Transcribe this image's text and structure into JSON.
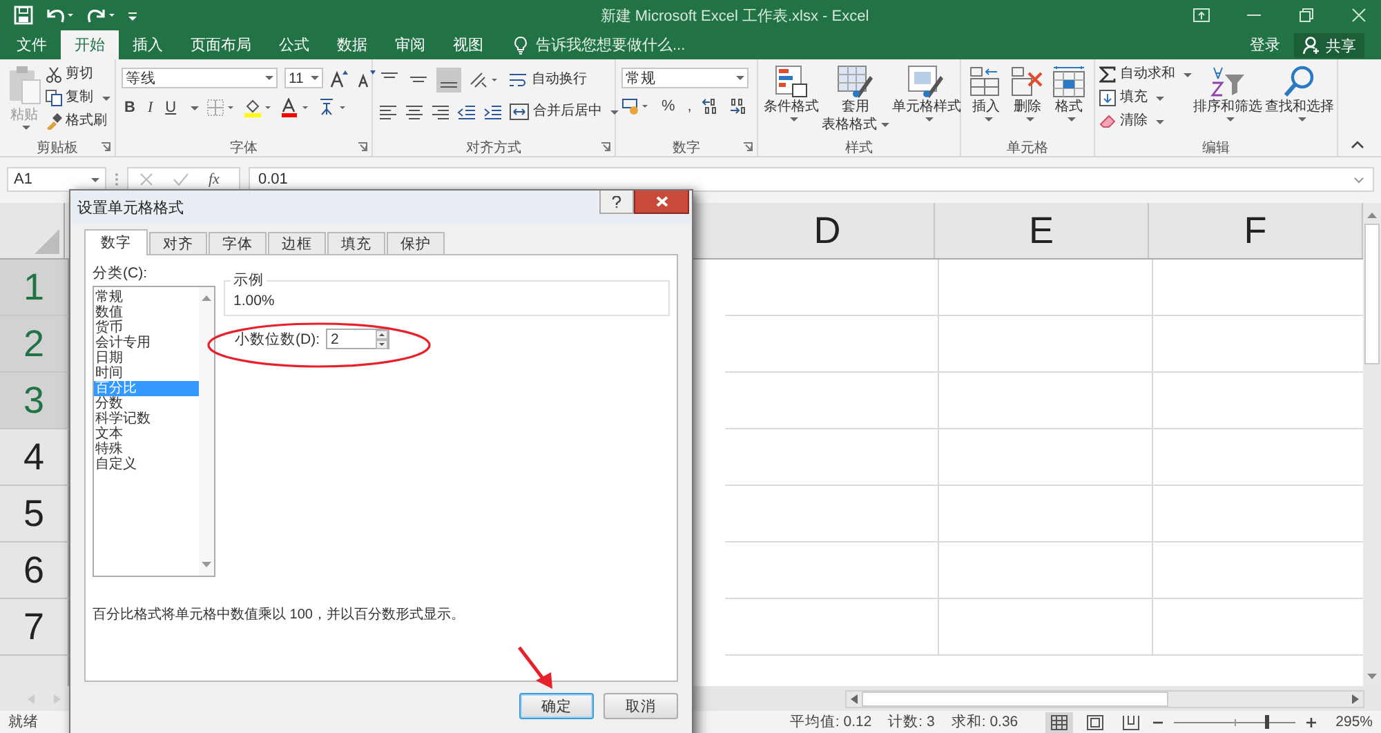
{
  "window": {
    "title": "新建 Microsoft Excel 工作表.xlsx - Excel"
  },
  "menu_tabs": [
    {
      "label": "文件",
      "selected": false
    },
    {
      "label": "开始",
      "selected": true
    },
    {
      "label": "插入",
      "selected": false
    },
    {
      "label": "页面布局",
      "selected": false
    },
    {
      "label": "公式",
      "selected": false
    },
    {
      "label": "数据",
      "selected": false
    },
    {
      "label": "审阅",
      "selected": false
    },
    {
      "label": "视图",
      "selected": false
    }
  ],
  "tell_me": {
    "placeholder": "告诉我您想要做什么..."
  },
  "account": {
    "sign_in": "登录",
    "share": "共享"
  },
  "ribbon": {
    "clipboard": {
      "label": "剪贴板",
      "paste": "粘贴",
      "cut": "剪切",
      "copy": "复制",
      "format_painter": "格式刷"
    },
    "font": {
      "label": "字体",
      "font_name": "等线",
      "font_size": "11",
      "bold": "B",
      "italic": "I",
      "underline": "U"
    },
    "alignment": {
      "label": "对齐方式",
      "wrap_text": "自动换行",
      "merge_center": "合并后居中"
    },
    "number": {
      "label": "数字",
      "format": "常规",
      "percent": "%",
      "comma": ","
    },
    "styles": {
      "label": "样式",
      "conditional": "条件格式",
      "table_format": [
        "套用",
        "表格格式"
      ],
      "cell_styles": "单元格样式"
    },
    "cells": {
      "label": "单元格",
      "insert": "插入",
      "delete": "删除",
      "format": "格式"
    },
    "editing": {
      "label": "编辑",
      "autosum": "自动求和",
      "fill": "填充",
      "clear": "清除",
      "sort_filter": "排序和筛选",
      "find_select": "查找和选择"
    }
  },
  "formula_bar": {
    "name_box": "A1",
    "insert_function": "fx",
    "value": "0.01"
  },
  "sheet": {
    "columns": [
      {
        "label": "D",
        "selected": false
      },
      {
        "label": "E",
        "selected": false
      },
      {
        "label": "F",
        "selected": false
      }
    ],
    "rows": [
      {
        "label": "1",
        "selected": true
      },
      {
        "label": "2",
        "selected": true
      },
      {
        "label": "3",
        "selected": true
      },
      {
        "label": "4",
        "selected": false
      },
      {
        "label": "5",
        "selected": false
      },
      {
        "label": "6",
        "selected": false
      },
      {
        "label": "7",
        "selected": false
      }
    ]
  },
  "status_bar": {
    "status": "就绪",
    "stats": [
      "平均值: 0.12",
      "计数: 3",
      "求和: 0.36"
    ],
    "views": [
      {
        "kind": "normal",
        "selected": true
      },
      {
        "kind": "page_layout",
        "selected": false
      },
      {
        "kind": "page_break",
        "selected": false
      }
    ],
    "zoom": {
      "level": 0.76,
      "value": "295%"
    }
  },
  "dialog": {
    "title": "设置单元格格式",
    "tabs": [
      {
        "label": "数字",
        "selected": true
      },
      {
        "label": "对齐",
        "selected": false
      },
      {
        "label": "字体",
        "selected": false
      },
      {
        "label": "边框",
        "selected": false
      },
      {
        "label": "填充",
        "selected": false
      },
      {
        "label": "保护",
        "selected": false
      }
    ],
    "category_label": "分类(C):",
    "categories": [
      {
        "label": "常规",
        "selected": false
      },
      {
        "label": "数值",
        "selected": false
      },
      {
        "label": "货币",
        "selected": false
      },
      {
        "label": "会计专用",
        "selected": false
      },
      {
        "label": "日期",
        "selected": false
      },
      {
        "label": "时间",
        "selected": false
      },
      {
        "label": "百分比",
        "selected": true
      },
      {
        "label": "分数",
        "selected": false
      },
      {
        "label": "科学记数",
        "selected": false
      },
      {
        "label": "文本",
        "selected": false
      },
      {
        "label": "特殊",
        "selected": false
      },
      {
        "label": "自定义",
        "selected": false
      }
    ],
    "sample": {
      "label": "示例",
      "value": "1.00%"
    },
    "decimal_places": {
      "label": "小数位数(D):",
      "value": "2"
    },
    "description": "百分比格式将单元格中数值乘以 100，并以百分数形式显示。",
    "buttons": [
      {
        "label": "确定",
        "focused": true
      },
      {
        "label": "取消",
        "focused": false
      }
    ]
  }
}
